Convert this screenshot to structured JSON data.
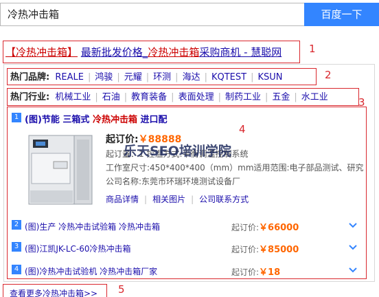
{
  "search": {
    "query": "冷热冲击箱",
    "button_label": "百度一下"
  },
  "result": {
    "title_hl": "【冷热冲击箱】",
    "title_mid": "最新批发价格_",
    "title_hl2": "冷热冲击箱",
    "title_tail": "采购商机 - 慧聪网"
  },
  "brands": {
    "label": "热门品牌:",
    "items": [
      "REALE",
      "鸿骏",
      "元耀",
      "环测",
      "海达",
      "KQTEST",
      "KSUN"
    ]
  },
  "industries": {
    "label": "热门行业:",
    "items": [
      "机械工业",
      "石油",
      "教育装备",
      "表面处理",
      "制药工业",
      "五金",
      "水工业"
    ]
  },
  "item1": {
    "num": "1",
    "title_pre": "(图)节能 三箱式 ",
    "title_hl": "冷热冲击箱",
    "title_post": " 进口配",
    "price_label": "起订价:",
    "price_value": "￥88888",
    "detail_line1": "起订量：1                      控温方式:平衡调温控制系统",
    "detail_line2": "工作室尺寸:450*400*400（mm）mm适用范围:电子部品测试、研究",
    "detail_line3": "公司名称:东莞市环瑞环境测试设备厂",
    "links": [
      "商品详情",
      "相关图片",
      "公司联系方式"
    ]
  },
  "watermark": "乐天SEO培训学院",
  "list": [
    {
      "num": "2",
      "title": "(图)生产 冷热冲击试验箱 冷热冲击箱",
      "price_label": "起订价:",
      "price_value": "￥66000"
    },
    {
      "num": "3",
      "title": "(图)江凯JK-LC-60冷热冲击箱",
      "price_label": "起订价:",
      "price_value": "￥85000"
    },
    {
      "num": "4",
      "title": "(图)冷热冲击试验机 冷热冲击箱厂家",
      "price_label": "起订价:",
      "price_value": "￥18"
    }
  ],
  "more_link": "查看更多冷热冲击箱>>",
  "annotations": [
    "1",
    "2",
    "3",
    "4",
    "5"
  ],
  "colors": {
    "accent": "#3385ff",
    "link": "#1a0dab",
    "highlight": "#c00",
    "price": "#f60",
    "annotation_box": "#d9262c"
  }
}
